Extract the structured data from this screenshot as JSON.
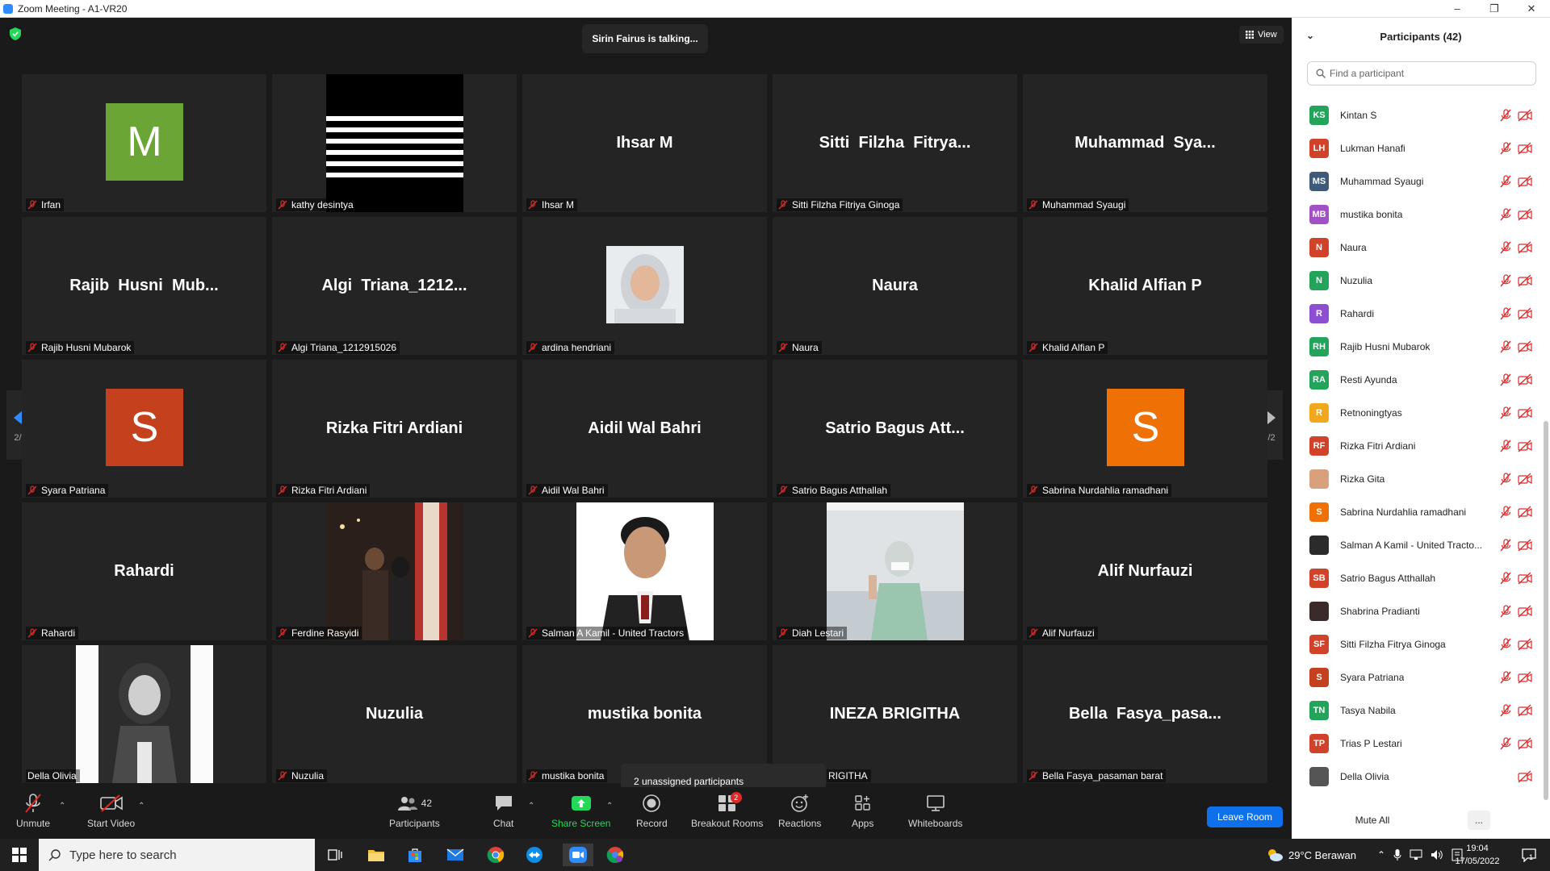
{
  "window": {
    "title": "Zoom Meeting - A1-VR20",
    "min": "–",
    "max": "❐",
    "close": "✕"
  },
  "meeting": {
    "talking": "Sirin Fairus is talking...",
    "view_label": "View",
    "page_left": "2/2",
    "page_right": "2/2",
    "unassigned": "2 unassigned participants"
  },
  "tiles": [
    {
      "label": "Irfan",
      "avatar_letter": "M",
      "avatar_color": "#6aa536"
    },
    {
      "label": "kathy desintya"
    },
    {
      "label": "Ihsar M",
      "center": "Ihsar M"
    },
    {
      "label": "Sitti Filzha Fitriya Ginoga",
      "center": "Sitti  Filzha  Fitrya..."
    },
    {
      "label": "Muhammad Syaugi",
      "center": "Muhammad  Sya..."
    },
    {
      "label": "Rajib Husni Mubarok",
      "center": "Rajib  Husni  Mub..."
    },
    {
      "label": "Algi Triana_1212915026",
      "center": "Algi  Triana_1212..."
    },
    {
      "label": "ardina hendriani"
    },
    {
      "label": "Naura",
      "center": "Naura"
    },
    {
      "label": "Khalid Alfian P",
      "center": "Khalid Alfian P"
    },
    {
      "label": "Syara Patriana",
      "avatar_letter": "S",
      "avatar_color": "#c5401c"
    },
    {
      "label": "Rizka Fitri Ardiani",
      "center": "Rizka Fitri Ardiani"
    },
    {
      "label": "Aidil Wal Bahri",
      "center": "Aidil Wal Bahri"
    },
    {
      "label": "Satrio Bagus Atthallah",
      "center": "Satrio Bagus Att..."
    },
    {
      "label": "Sabrina Nurdahlia ramadhani",
      "avatar_letter": "S",
      "avatar_color": "#ef7106"
    },
    {
      "label": "Rahardi",
      "center": "Rahardi"
    },
    {
      "label": "Ferdine Rasyidi"
    },
    {
      "label": "Salman A Kamil - United Tractors"
    },
    {
      "label": "Diah Lestari"
    },
    {
      "label": "Alif Nurfauzi",
      "center": "Alif Nurfauzi"
    },
    {
      "label": "Della Olivia"
    },
    {
      "label": "Nuzulia",
      "center": "Nuzulia"
    },
    {
      "label": "mustika bonita",
      "center": "mustika bonita"
    },
    {
      "label": "RIGITHA",
      "center": "INEZA BRIGITHA"
    },
    {
      "label": "Bella Fasya_pasaman barat",
      "center": "Bella  Fasya_pasa..."
    }
  ],
  "toolbar": {
    "unmute": "Unmute",
    "start_video": "Start Video",
    "participants": "Participants",
    "participants_count": "42",
    "chat": "Chat",
    "share": "Share Screen",
    "record": "Record",
    "breakout": "Breakout Rooms",
    "breakout_badge": "2",
    "reactions": "Reactions",
    "apps": "Apps",
    "whiteboards": "Whiteboards",
    "leave": "Leave Room"
  },
  "panel": {
    "title": "Participants (42)",
    "search_placeholder": "Find a participant",
    "mute_all": "Mute All",
    "more": "...",
    "participants": [
      {
        "initials": "KS",
        "name": "Kintan S",
        "color": "#23a45a"
      },
      {
        "initials": "LH",
        "name": "Lukman Hanafi",
        "color": "#d0432a"
      },
      {
        "initials": "MS",
        "name": "Muhammad Syaugi",
        "color": "#3f5a7a"
      },
      {
        "initials": "MB",
        "name": "mustika bonita",
        "color": "#a34fc6"
      },
      {
        "initials": "N",
        "name": "Naura",
        "color": "#d0432a"
      },
      {
        "initials": "N",
        "name": "Nuzulia",
        "color": "#23a45a"
      },
      {
        "initials": "R",
        "name": "Rahardi",
        "color": "#8c4fd1"
      },
      {
        "initials": "RH",
        "name": "Rajib Husni Mubarok",
        "color": "#23a45a"
      },
      {
        "initials": "RA",
        "name": "Resti Ayunda",
        "color": "#23a45a"
      },
      {
        "initials": "R",
        "name": "Retnoningtyas",
        "color": "#f2a81d"
      },
      {
        "initials": "RF",
        "name": "Rizka Fitri Ardiani",
        "color": "#d0432a"
      },
      {
        "initials": "",
        "name": "Rizka Gita",
        "color": "#d9a07c"
      },
      {
        "initials": "S",
        "name": "Sabrina Nurdahlia ramadhani",
        "color": "#ef7106"
      },
      {
        "initials": "",
        "name": "Salman A Kamil - United Tracto...",
        "color": "#2b2b2b"
      },
      {
        "initials": "SB",
        "name": "Satrio Bagus Atthallah",
        "color": "#d0432a"
      },
      {
        "initials": "",
        "name": "Shabrina Pradianti",
        "color": "#3a2a2a"
      },
      {
        "initials": "SF",
        "name": "Sitti Filzha Fitrya Ginoga",
        "color": "#d0432a"
      },
      {
        "initials": "S",
        "name": "Syara Patriana",
        "color": "#c5401c"
      },
      {
        "initials": "TN",
        "name": "Tasya Nabila",
        "color": "#23a45a"
      },
      {
        "initials": "TP",
        "name": "Trias P Lestari",
        "color": "#d0432a"
      },
      {
        "initials": "",
        "name": "Della Olivia",
        "color": "#555555"
      }
    ]
  },
  "taskbar": {
    "search_placeholder": "Type here to search",
    "weather": "29°C  Berawan",
    "time": "19:04",
    "date": "17/05/2022",
    "notif_count": "1"
  },
  "colors": {
    "accent": "#0e71eb",
    "muted_red": "#e02828",
    "share_green": "#23d959"
  }
}
